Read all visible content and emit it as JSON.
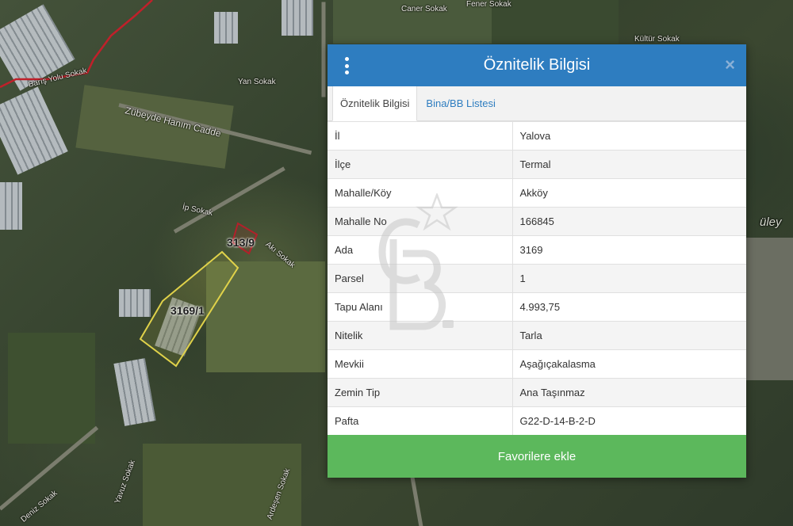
{
  "map": {
    "street_labels": [
      "Caner Sokak",
      "Fener Sokak",
      "Barış Yolu Sokak",
      "Yan Sokak",
      "Zübeyde Hanım Cadde",
      "İp Sokak",
      "Akı Sokak",
      "Ardeşen Sokak",
      "Yavuz Sokak",
      "Deniz Sokak",
      "Kültür Sokak",
      "üley"
    ],
    "parcel_labels": [
      "313/9",
      "3169/1"
    ]
  },
  "popup": {
    "title": "Öznitelik Bilgisi",
    "close_glyph": "×",
    "tabs": [
      {
        "label": "Öznitelik Bilgisi",
        "active": true
      },
      {
        "label": "Bina/BB Listesi",
        "active": false
      }
    ],
    "rows": [
      {
        "key": "İl",
        "value": "Yalova"
      },
      {
        "key": "İlçe",
        "value": "Termal"
      },
      {
        "key": "Mahalle/Köy",
        "value": "Akköy"
      },
      {
        "key": "Mahalle No",
        "value": "166845"
      },
      {
        "key": "Ada",
        "value": "3169"
      },
      {
        "key": "Parsel",
        "value": "1"
      },
      {
        "key": "Tapu Alanı",
        "value": "4.993,75"
      },
      {
        "key": "Nitelik",
        "value": "Tarla"
      },
      {
        "key": "Mevkii",
        "value": "Aşağıçakalasma"
      },
      {
        "key": "Zemin Tip",
        "value": "Ana Taşınmaz"
      },
      {
        "key": "Pafta",
        "value": "G22-D-14-B-2-D"
      }
    ],
    "favorite_button": "Favorilere ekle"
  },
  "watermark": {
    "letters": "CB",
    "mark": "SM"
  },
  "colors": {
    "header_blue": "#2e7dc0",
    "button_green": "#5cb85c",
    "parcel_yellow": "#e0d24a",
    "parcel_red": "#b3202a",
    "boundary_red": "#c0202a"
  }
}
